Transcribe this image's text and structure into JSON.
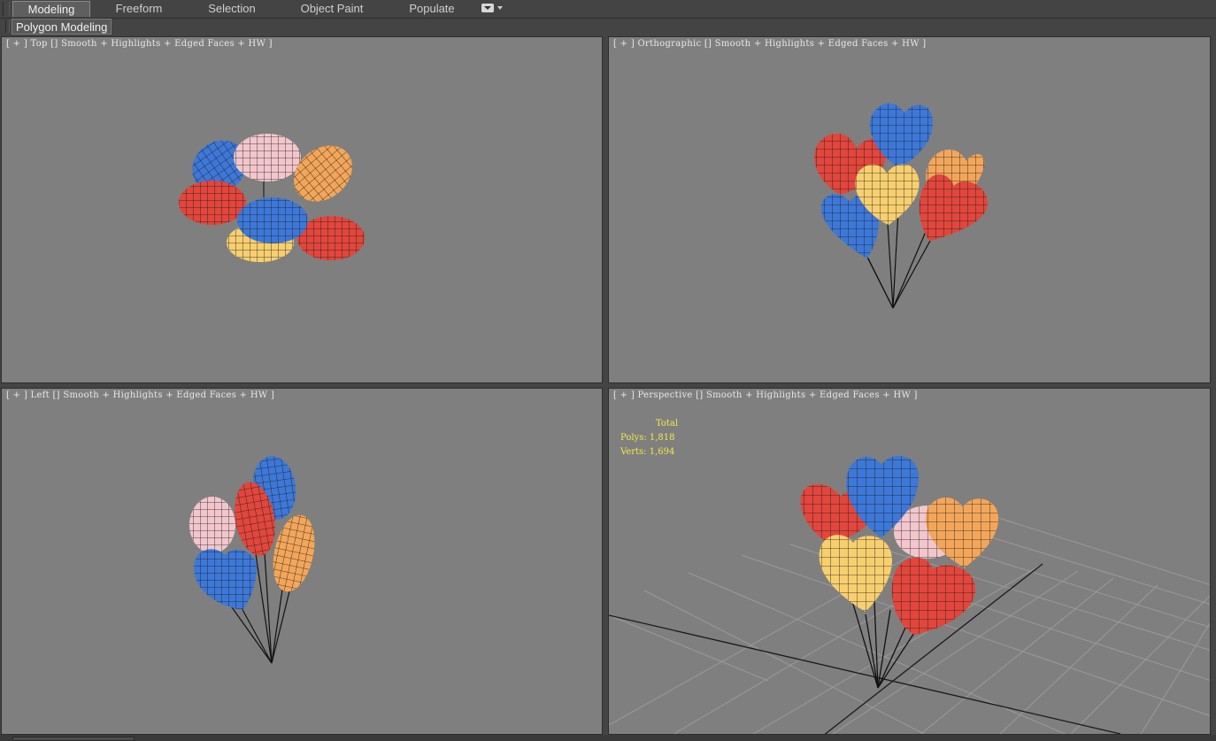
{
  "ribbon": {
    "tabs": [
      {
        "label": "Modeling",
        "active": true
      },
      {
        "label": "Freeform",
        "active": false
      },
      {
        "label": "Selection",
        "active": false
      },
      {
        "label": "Object Paint",
        "active": false
      },
      {
        "label": "Populate",
        "active": false
      }
    ],
    "panel_label": "Polygon Modeling",
    "options_icon": "dropdown-icon"
  },
  "viewports": {
    "top": {
      "label": "[ + ] Top [] Smooth + Highlights + Edged Faces + HW ]"
    },
    "ortho": {
      "label": "[ + ] Orthographic [] Smooth + Highlights + Edged Faces + HW ]"
    },
    "left": {
      "label": "[ + ] Left [] Smooth + Highlights + Edged Faces + HW ]"
    },
    "persp": {
      "label": "[ + ] Perspective [] Smooth + Highlights + Edged Faces + HW ]",
      "stats": {
        "total": "Total",
        "polys": "Polys: 1,818",
        "verts": "Verts: 1,694"
      }
    }
  },
  "colors": {
    "viewport_bg": "#7f7f7f",
    "ui_bg": "#444444",
    "stats_text": "#f4e84a",
    "balloon_red": "#e2463c",
    "balloon_blue": "#3d78d8",
    "balloon_yellow": "#f7cf6f",
    "balloon_orange": "#f3a65a",
    "balloon_pink": "#f2c6cc"
  }
}
